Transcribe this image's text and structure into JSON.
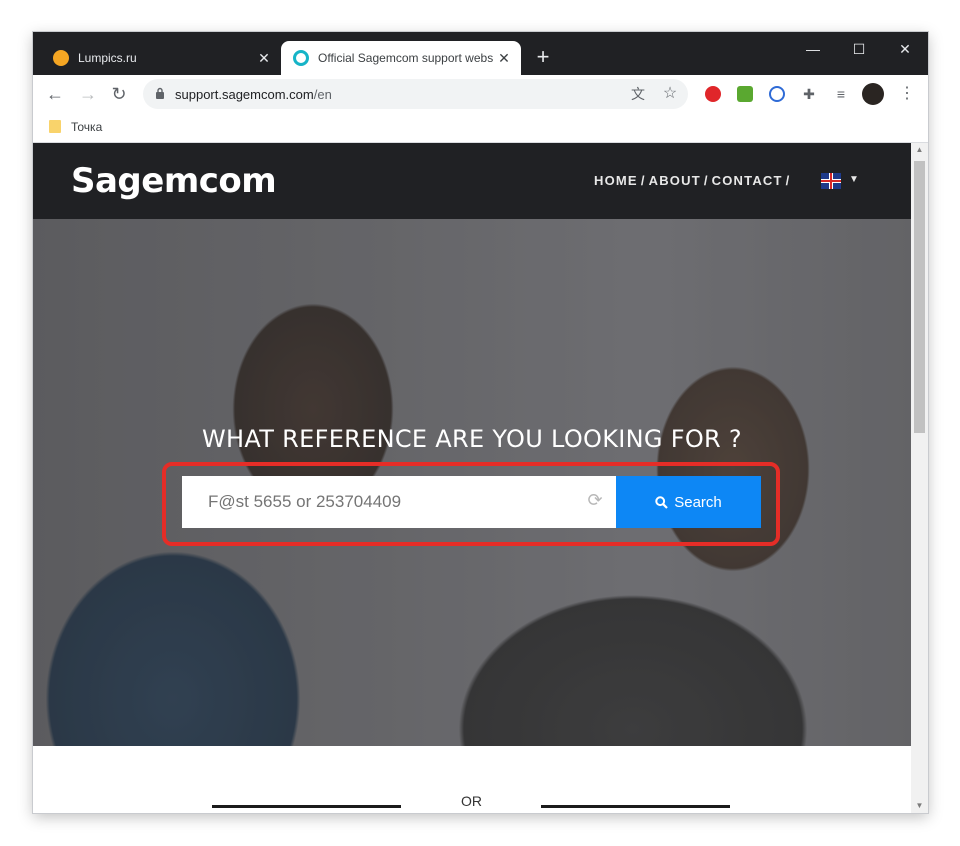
{
  "tabs": [
    {
      "title": "Lumpics.ru",
      "favicon": "lumpics-favicon"
    },
    {
      "title": "Official Sagemcom support webs",
      "favicon": "sagemcom-favicon"
    }
  ],
  "toolbar": {
    "url_host": "support.sagemcom.com",
    "url_path": "/en"
  },
  "bookmarks": [
    {
      "label": "Точка"
    }
  ],
  "site": {
    "logo": "Sagemcom",
    "nav": [
      "HOME",
      "ABOUT",
      "CONTACT"
    ],
    "nav_sep": "/",
    "language": "en-GB"
  },
  "hero": {
    "title": "WHAT REFERENCE ARE YOU LOOKING FOR ?",
    "search_placeholder": "F@st 5655 or 253704409",
    "search_button": "Search"
  },
  "or_text": "OR",
  "colors": {
    "search_button": "#0d87f5",
    "highlight": "#e52d27",
    "header": "#202124"
  }
}
